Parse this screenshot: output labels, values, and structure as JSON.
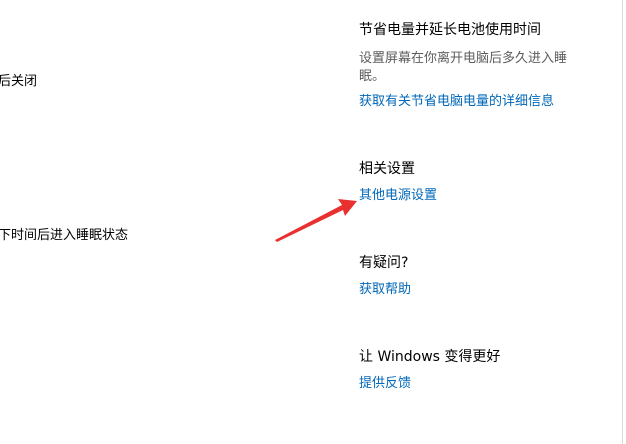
{
  "left": {
    "line1": "后关闭",
    "line2": "下时间后进入睡眠状态"
  },
  "sections": {
    "save_power": {
      "title": "节省电量并延长电池使用时间",
      "description": "设置屏幕在你离开电脑后多久进入睡眠。",
      "link": "获取有关节省电脑电量的详细信息"
    },
    "related": {
      "title": "相关设置",
      "link": "其他电源设置"
    },
    "questions": {
      "title": "有疑问?",
      "link": "获取帮助"
    },
    "feedback": {
      "title": "让 Windows 变得更好",
      "link": "提供反馈"
    }
  },
  "annotation": {
    "arrow_color": "#e8312f"
  },
  "colors": {
    "link": "#0067b8",
    "description": "#5c5c5c"
  }
}
